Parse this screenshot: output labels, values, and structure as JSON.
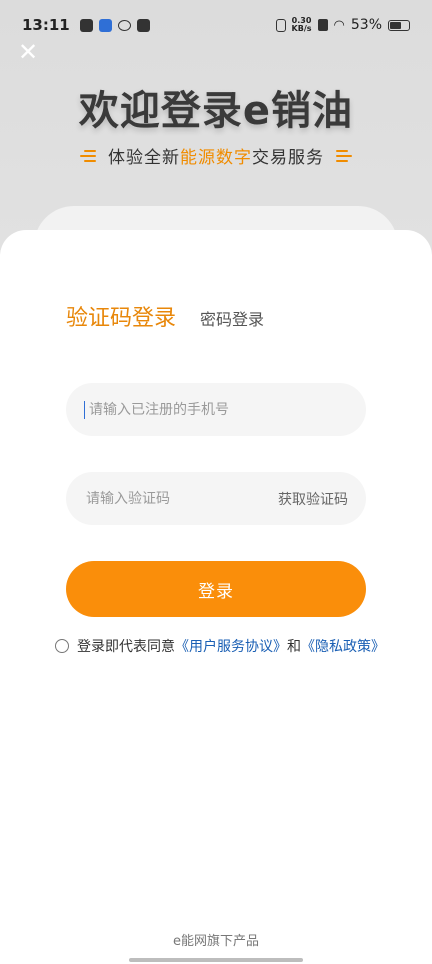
{
  "status_bar": {
    "time": "13:11",
    "network_speed_top": "0.30",
    "network_speed_bottom": "KB/s",
    "battery": "53%"
  },
  "hero": {
    "title": "欢迎登录e销油",
    "subtitle_prefix": "体验全新",
    "subtitle_highlight": "能源数字",
    "subtitle_suffix": "交易服务"
  },
  "tabs": [
    {
      "label": "验证码登录",
      "active": true
    },
    {
      "label": "密码登录",
      "active": false
    }
  ],
  "form": {
    "phone_placeholder": "请输入已注册的手机号",
    "code_placeholder": "请输入验证码",
    "get_code_label": "获取验证码",
    "login_label": "登录"
  },
  "agreement": {
    "prefix": "登录即代表同意",
    "user_agreement": "《用户服务协议》",
    "and": "和",
    "privacy_policy": "《隐私政策》"
  },
  "footer": {
    "text": "e能网旗下产品"
  },
  "colors": {
    "accent": "#fa8e0a",
    "link": "#1a5fb4"
  },
  "icons": [
    "close-icon",
    "mail-icon",
    "wifi-icon",
    "battery-icon",
    "radio-icon"
  ]
}
